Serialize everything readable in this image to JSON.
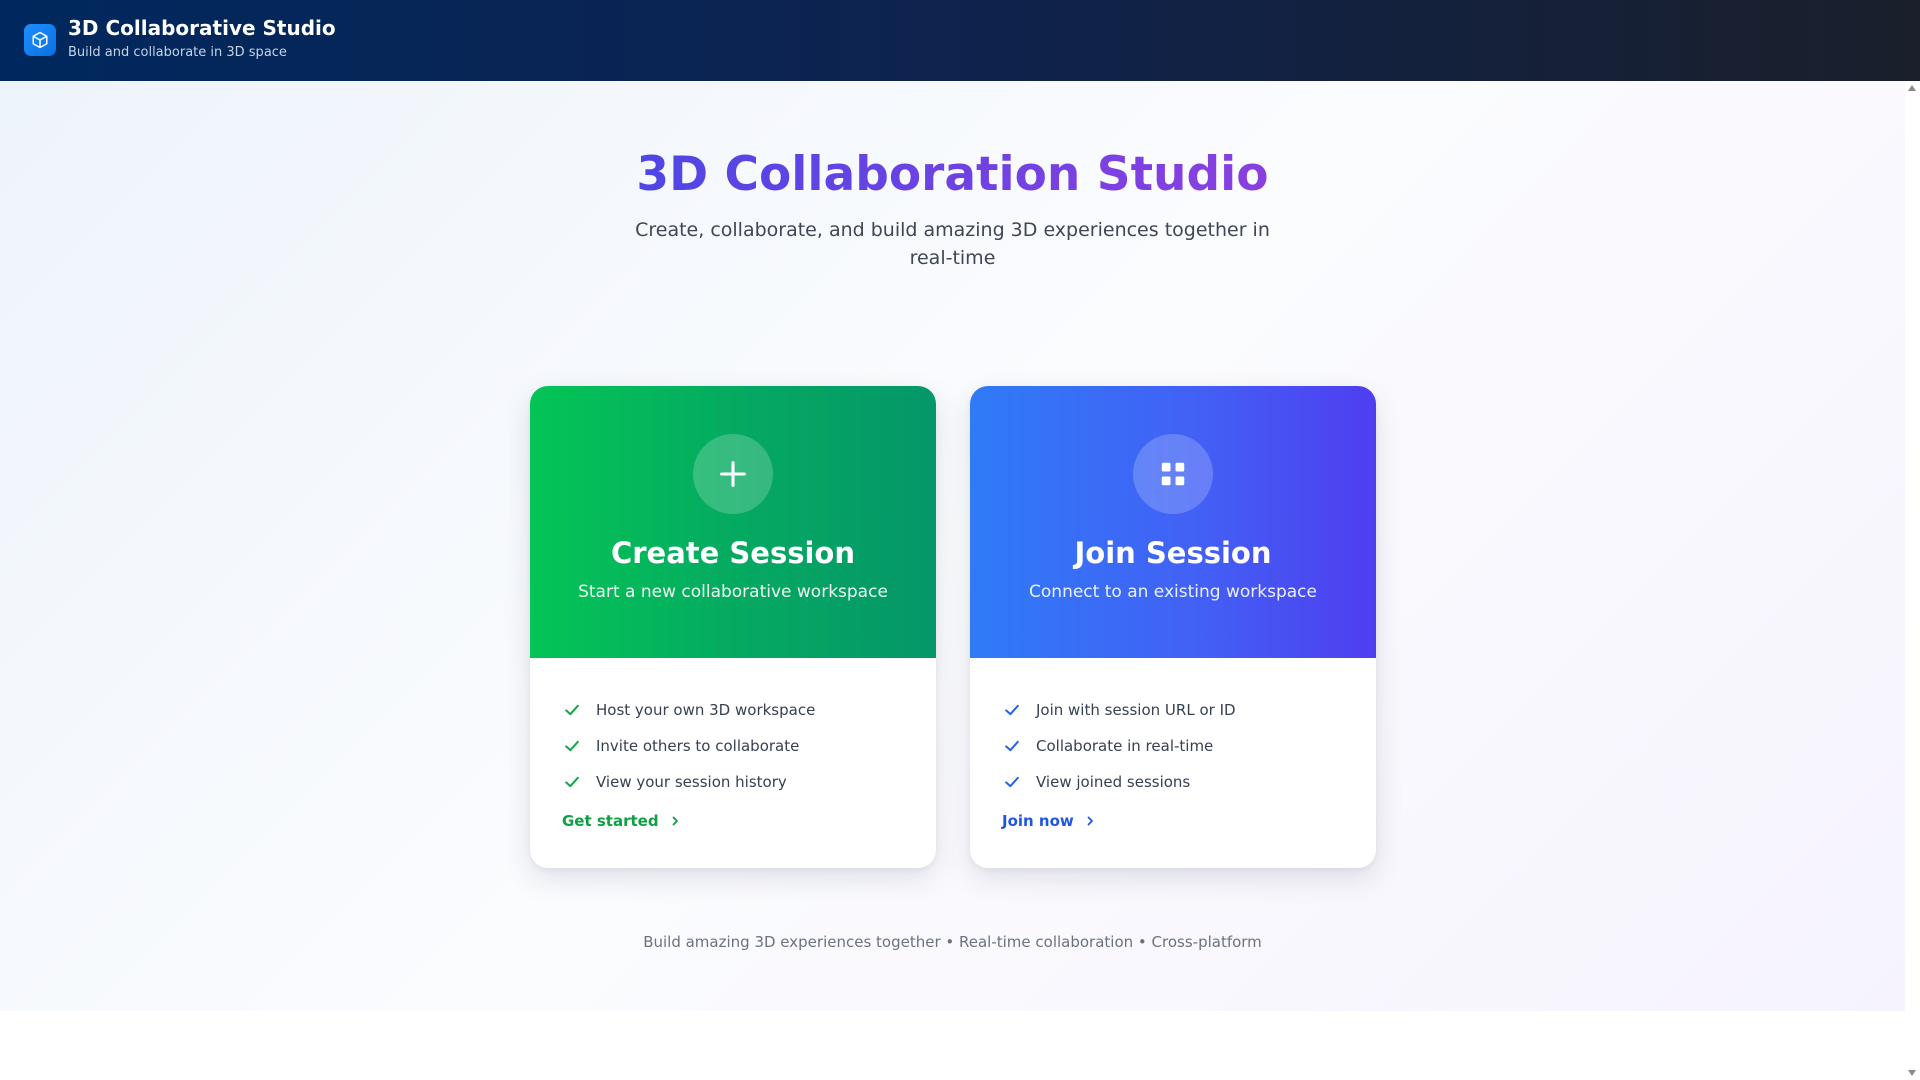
{
  "header": {
    "title": "3D Collaborative Studio",
    "subtitle": "Build and collaborate in 3D space",
    "logo_icon": "cube-icon"
  },
  "hero": {
    "title": "3D Collaboration Studio",
    "description": "Create, collaborate, and build amazing 3D experiences together in real-time"
  },
  "cards": {
    "create": {
      "icon": "plus-icon",
      "title": "Create Session",
      "description": "Start a new collaborative workspace",
      "features": [
        "Host your own 3D workspace",
        "Invite others to collaborate",
        "View your session history"
      ],
      "cta": "Get started",
      "accent": "#059669"
    },
    "join": {
      "icon": "grid-icon",
      "title": "Join Session",
      "description": "Connect to an existing workspace",
      "features": [
        "Join with session URL or ID",
        "Collaborate in real-time",
        "View joined sessions"
      ],
      "cta": "Join now",
      "accent": "#2563eb"
    }
  },
  "footer": {
    "text": "Build amazing 3D experiences together • Real-time collaboration • Cross-platform"
  }
}
